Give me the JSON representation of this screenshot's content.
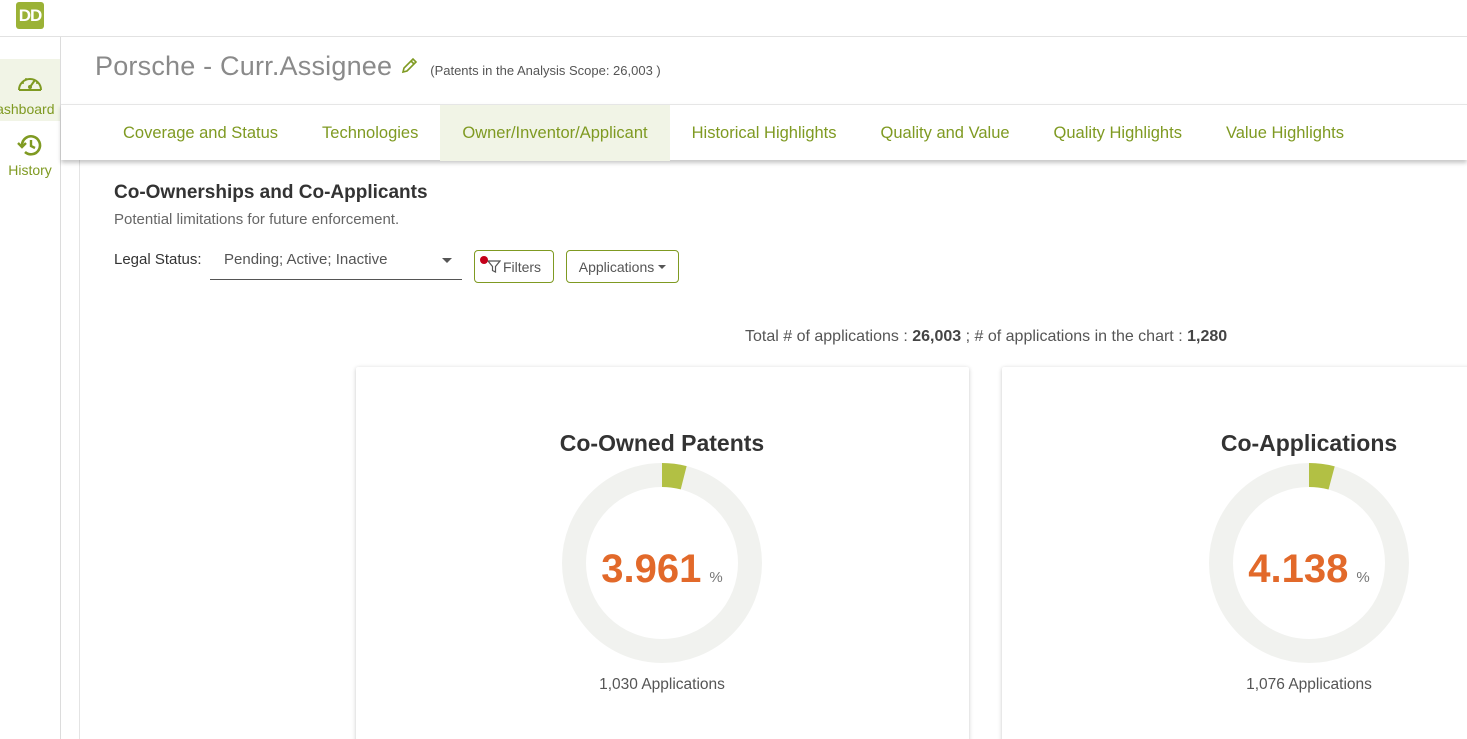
{
  "app": {
    "logo_text": "DD"
  },
  "sidebar": {
    "items": [
      {
        "label": "Dashboard",
        "icon": "gauge-icon"
      },
      {
        "label": "History",
        "icon": "history-icon"
      }
    ]
  },
  "header": {
    "title": "Porsche - Curr.Assignee",
    "scope": "(Patents in the Analysis Scope: 26,003 )"
  },
  "tabs": [
    {
      "label": "Coverage and Status"
    },
    {
      "label": "Technologies"
    },
    {
      "label": "Owner/Inventor/Applicant",
      "active": true
    },
    {
      "label": "Historical Highlights"
    },
    {
      "label": "Quality and Value"
    },
    {
      "label": "Quality Highlights"
    },
    {
      "label": "Value Highlights"
    }
  ],
  "section": {
    "title": "Co-Ownerships and Co-Applicants",
    "subtitle": "Potential limitations for future enforcement."
  },
  "filters": {
    "legal_status_label": "Legal Status:",
    "legal_status_value": "Pending; Active; Inactive",
    "filters_button": "Filters",
    "applications_button": "Applications"
  },
  "totals": {
    "total_label": "Total # of applications :",
    "total_value": "26,003",
    "separator": ";",
    "chart_label": "# of applications in the chart :",
    "chart_value": "1,280"
  },
  "colors": {
    "accent": "#7f9a22",
    "donut_fill": "#b2c044",
    "donut_track": "#f1f2ef",
    "value_orange": "#e2692a"
  },
  "cards": [
    {
      "title": "Co-Owned Patents",
      "value": "3.961",
      "unit": "%",
      "percent": 3.961,
      "footer": "1,030 Applications"
    },
    {
      "title": "Co-Applications",
      "value": "4.138",
      "unit": "%",
      "percent": 4.138,
      "footer": "1,076 Applications"
    }
  ]
}
